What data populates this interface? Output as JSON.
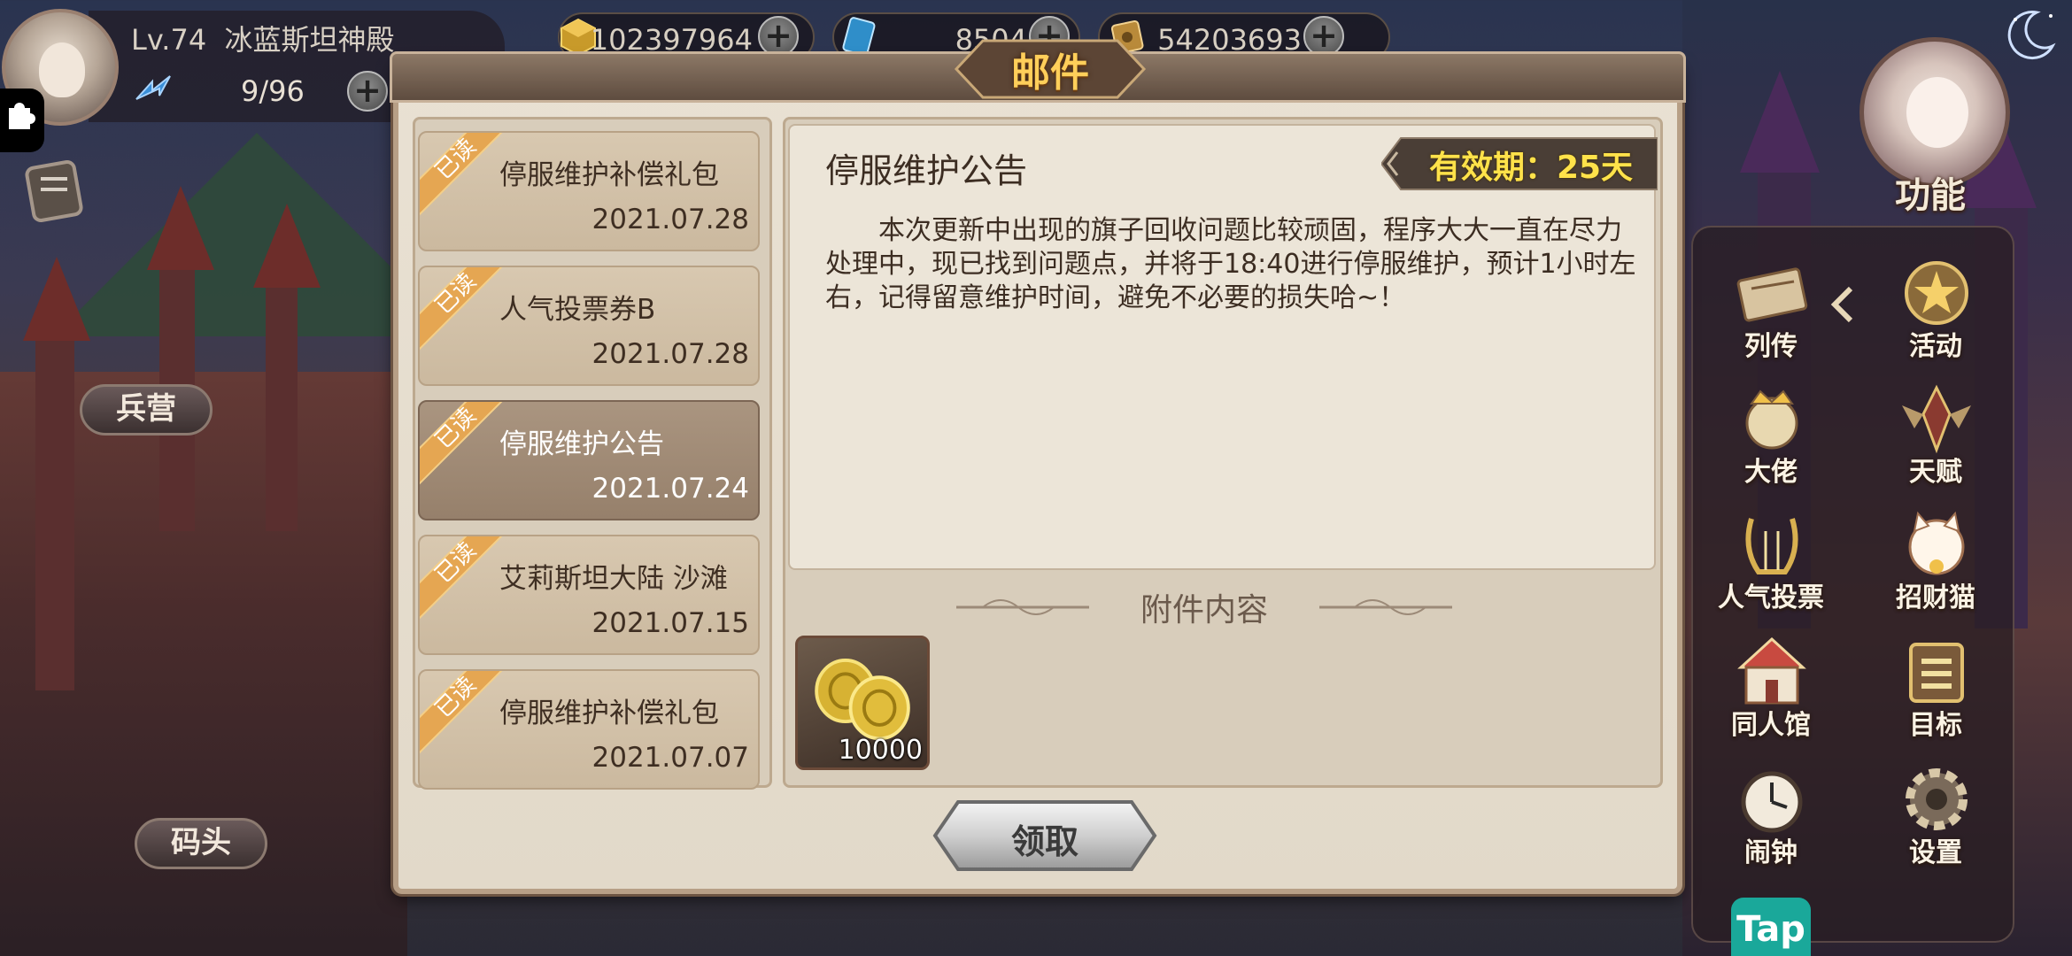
{
  "hud": {
    "level": "Lv.74",
    "server": "冰蓝斯坦神殿",
    "ap": "9/96",
    "gold": "102397964",
    "gems": "8504",
    "coupons": "54203693"
  },
  "map_labels": {
    "barracks": "兵营",
    "dock": "码头"
  },
  "function_menu": {
    "title": "功能",
    "items": [
      {
        "label": "列传",
        "icon": "book-icon"
      },
      {
        "label": "活动",
        "icon": "star-badge-icon"
      },
      {
        "label": "大佬",
        "icon": "crown-mascot-icon"
      },
      {
        "label": "天赋",
        "icon": "winged-emblem-icon"
      },
      {
        "label": "人气投票",
        "icon": "lyre-icon"
      },
      {
        "label": "招财猫",
        "icon": "lucky-cat-icon"
      },
      {
        "label": "同人馆",
        "icon": "gallery-tent-icon"
      },
      {
        "label": "目标",
        "icon": "target-board-icon"
      },
      {
        "label": "闹钟",
        "icon": "alarm-clock-icon"
      },
      {
        "label": "设置",
        "icon": "gear-icon"
      }
    ],
    "tap_badge": "Tap"
  },
  "mail": {
    "title": "邮件",
    "read_tag": "已读",
    "items": [
      {
        "title": "停服维护补偿礼包",
        "date": "2021.07.28"
      },
      {
        "title": "人气投票券B",
        "date": "2021.07.28"
      },
      {
        "title": "停服维护公告",
        "date": "2021.07.24"
      },
      {
        "title": "艾莉斯坦大陆 沙滩",
        "date": "2021.07.15"
      },
      {
        "title": "停服维护补偿礼包",
        "date": "2021.07.07"
      }
    ],
    "selected_index": 2,
    "detail": {
      "title": "停服维护公告",
      "validity": "有效期：25天",
      "body": "本次更新中出现的旗子回收问题比较顽固，程序大大一直在尽力处理中，现已找到问题点，并将于18:40进行停服维护，预计1小时左右，记得留意维护时间，避免不必要的损失哈~！",
      "attachment_title": "附件内容",
      "attachment": {
        "icon": "gold-coins-icon",
        "count": "10000"
      },
      "claim_label": "领取"
    }
  },
  "colors": {
    "title_gold": "#ffcf5a",
    "validity_yellow": "#ffe24a",
    "selected_item": "#a08b76",
    "panel_beige": "#e9e1d3"
  }
}
